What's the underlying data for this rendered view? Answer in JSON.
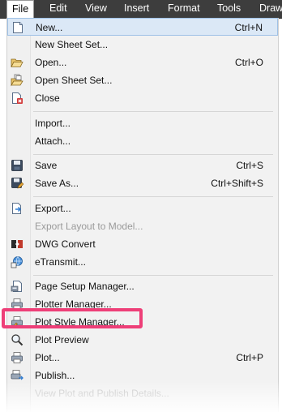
{
  "menubar": {
    "items": [
      {
        "label": "File",
        "active": true
      },
      {
        "label": "Edit"
      },
      {
        "label": "View"
      },
      {
        "label": "Insert"
      },
      {
        "label": "Format"
      },
      {
        "label": "Tools"
      },
      {
        "label": "Draw"
      }
    ]
  },
  "menu": {
    "items": [
      {
        "label": "New...",
        "shortcut": "Ctrl+N",
        "icon": "new-file-icon"
      },
      {
        "label": "New Sheet Set...",
        "icon": ""
      },
      {
        "label": "Open...",
        "shortcut": "Ctrl+O",
        "icon": "open-folder-icon"
      },
      {
        "label": "Open Sheet Set...",
        "icon": "open-sheet-set-icon"
      },
      {
        "label": "Close",
        "icon": "close-drawing-icon"
      },
      {
        "label": "Import...",
        "icon": ""
      },
      {
        "label": "Attach...",
        "icon": ""
      },
      {
        "label": "Save",
        "shortcut": "Ctrl+S",
        "icon": "save-icon"
      },
      {
        "label": "Save As...",
        "shortcut": "Ctrl+Shift+S",
        "icon": "save-as-icon"
      },
      {
        "label": "Export...",
        "icon": "export-icon"
      },
      {
        "label": "Export Layout to Model...",
        "disabled": true,
        "icon": ""
      },
      {
        "label": "DWG Convert",
        "icon": "dwg-convert-icon"
      },
      {
        "label": "eTransmit...",
        "icon": "etransmit-icon"
      },
      {
        "label": "Page Setup Manager...",
        "icon": "page-setup-icon"
      },
      {
        "label": "Plotter Manager...",
        "icon": "plotter-icon"
      },
      {
        "label": "Plot Style Manager...",
        "icon": "plot-style-icon"
      },
      {
        "label": "Plot Preview",
        "icon": "plot-preview-icon"
      },
      {
        "label": "Plot...",
        "shortcut": "Ctrl+P",
        "icon": "plot-icon"
      },
      {
        "label": "Publish...",
        "icon": "publish-icon"
      },
      {
        "label": "View Plot and Publish Details...",
        "faded": true,
        "icon": ""
      }
    ]
  },
  "colors": {
    "menubar_bg": "#3d3d3d",
    "highlight_border": "#ee3f78",
    "hover_bg": "#dbe8f6"
  }
}
